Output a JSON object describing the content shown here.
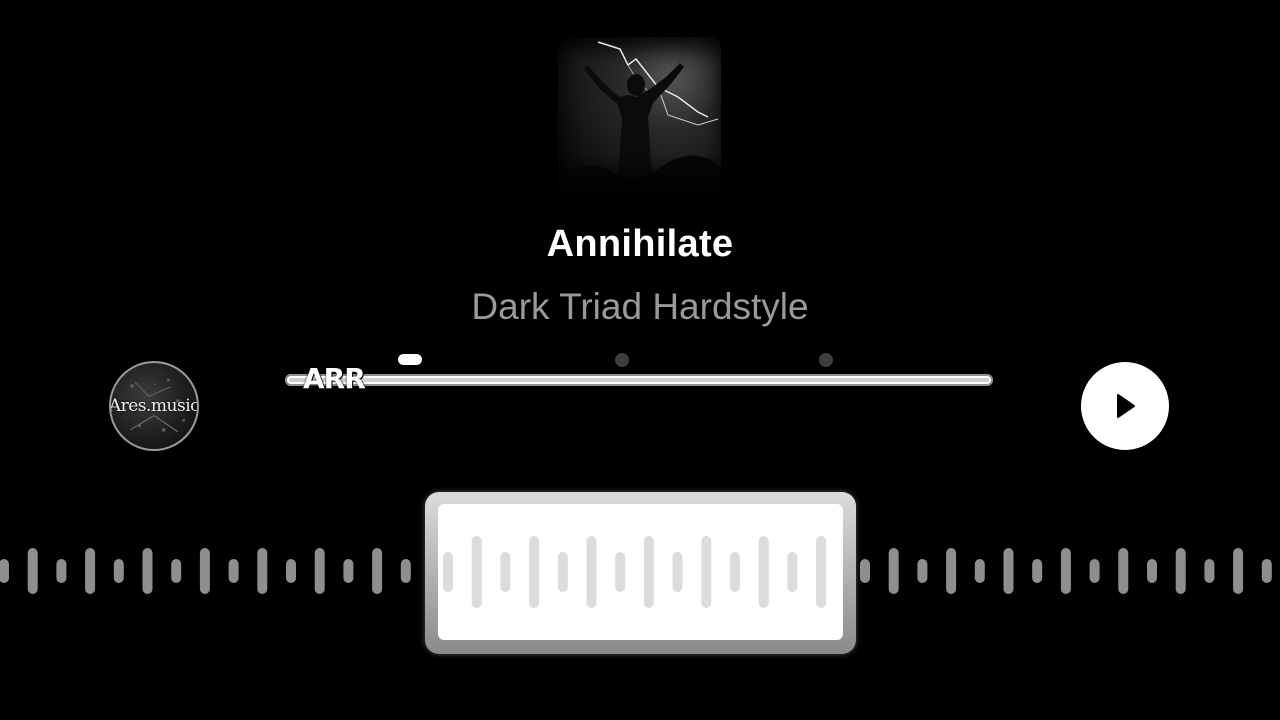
{
  "track": {
    "title": "Annihilate",
    "artist": "Dark Triad Hardstyle"
  },
  "channel": {
    "logo_text": "Ares.music"
  },
  "progress": {
    "label": "ARR",
    "value": 0.0
  },
  "controls": {
    "play_icon": "play-icon"
  },
  "colors": {
    "background": "#000000",
    "accent": "#ffffff",
    "muted_text": "#9a9a9a"
  }
}
